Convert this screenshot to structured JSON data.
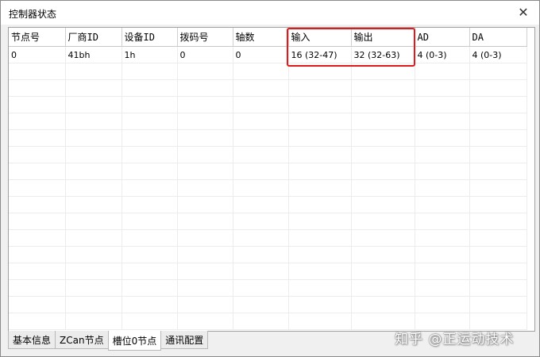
{
  "window": {
    "title": "控制器状态",
    "close_glyph": "✕"
  },
  "table": {
    "columns": [
      "节点号",
      "厂商ID",
      "设备ID",
      "拨码号",
      "轴数",
      "输入",
      "输出",
      "AD",
      "DA"
    ],
    "rows": [
      [
        "0",
        "41bh",
        "1h",
        "0",
        "0",
        "16 (32-47)",
        "32 (32-63)",
        "4 (0-3)",
        "4 (0-3)"
      ]
    ],
    "highlight_color": "#e0191b"
  },
  "tabs": [
    {
      "label": "基本信息",
      "active": false
    },
    {
      "label": "ZCan节点",
      "active": false
    },
    {
      "label": "槽位0节点",
      "active": true
    },
    {
      "label": "通讯配置",
      "active": false
    }
  ],
  "watermark": {
    "text": "知乎 @正运动技术"
  }
}
